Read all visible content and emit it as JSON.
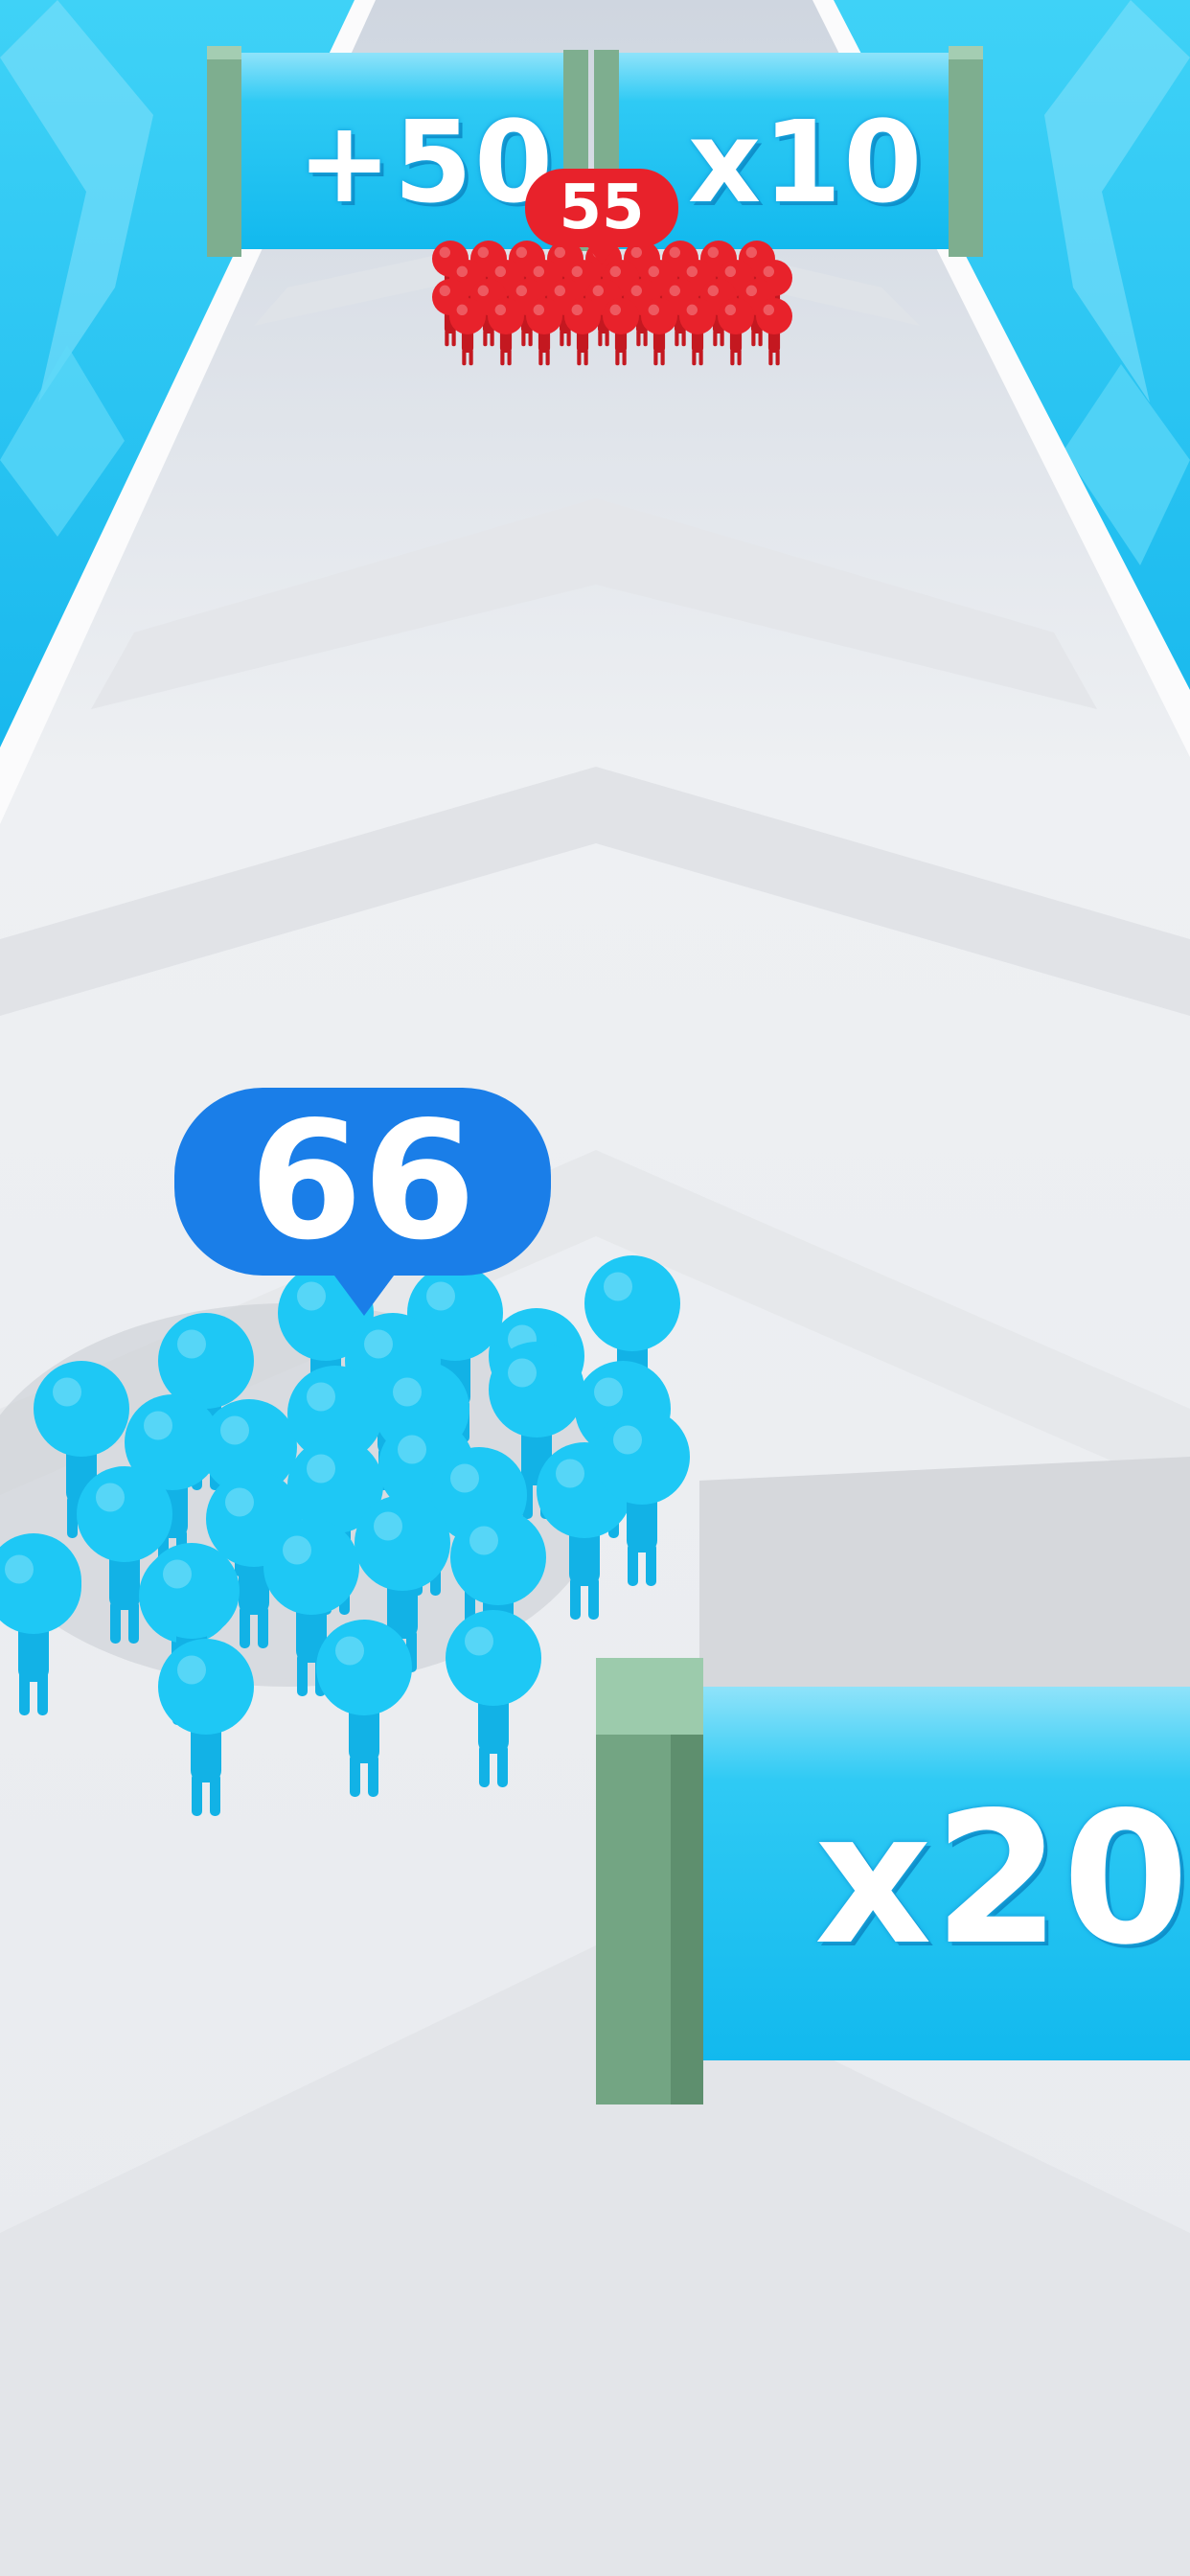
{
  "gates": {
    "top_left": {
      "label": "+50"
    },
    "top_right": {
      "label": "x10"
    },
    "bottom": {
      "label": "x20"
    }
  },
  "enemy_crowd": {
    "count": "55",
    "color": "#e8222b"
  },
  "player_crowd": {
    "count": "66",
    "color": "#1ec8f5",
    "bubble_color": "#1a7ee8"
  },
  "colors": {
    "ice": "#2cc8f2",
    "track": "#eeeff2",
    "gate_panel": "#18bdf0",
    "gate_post": "#79a98a"
  }
}
